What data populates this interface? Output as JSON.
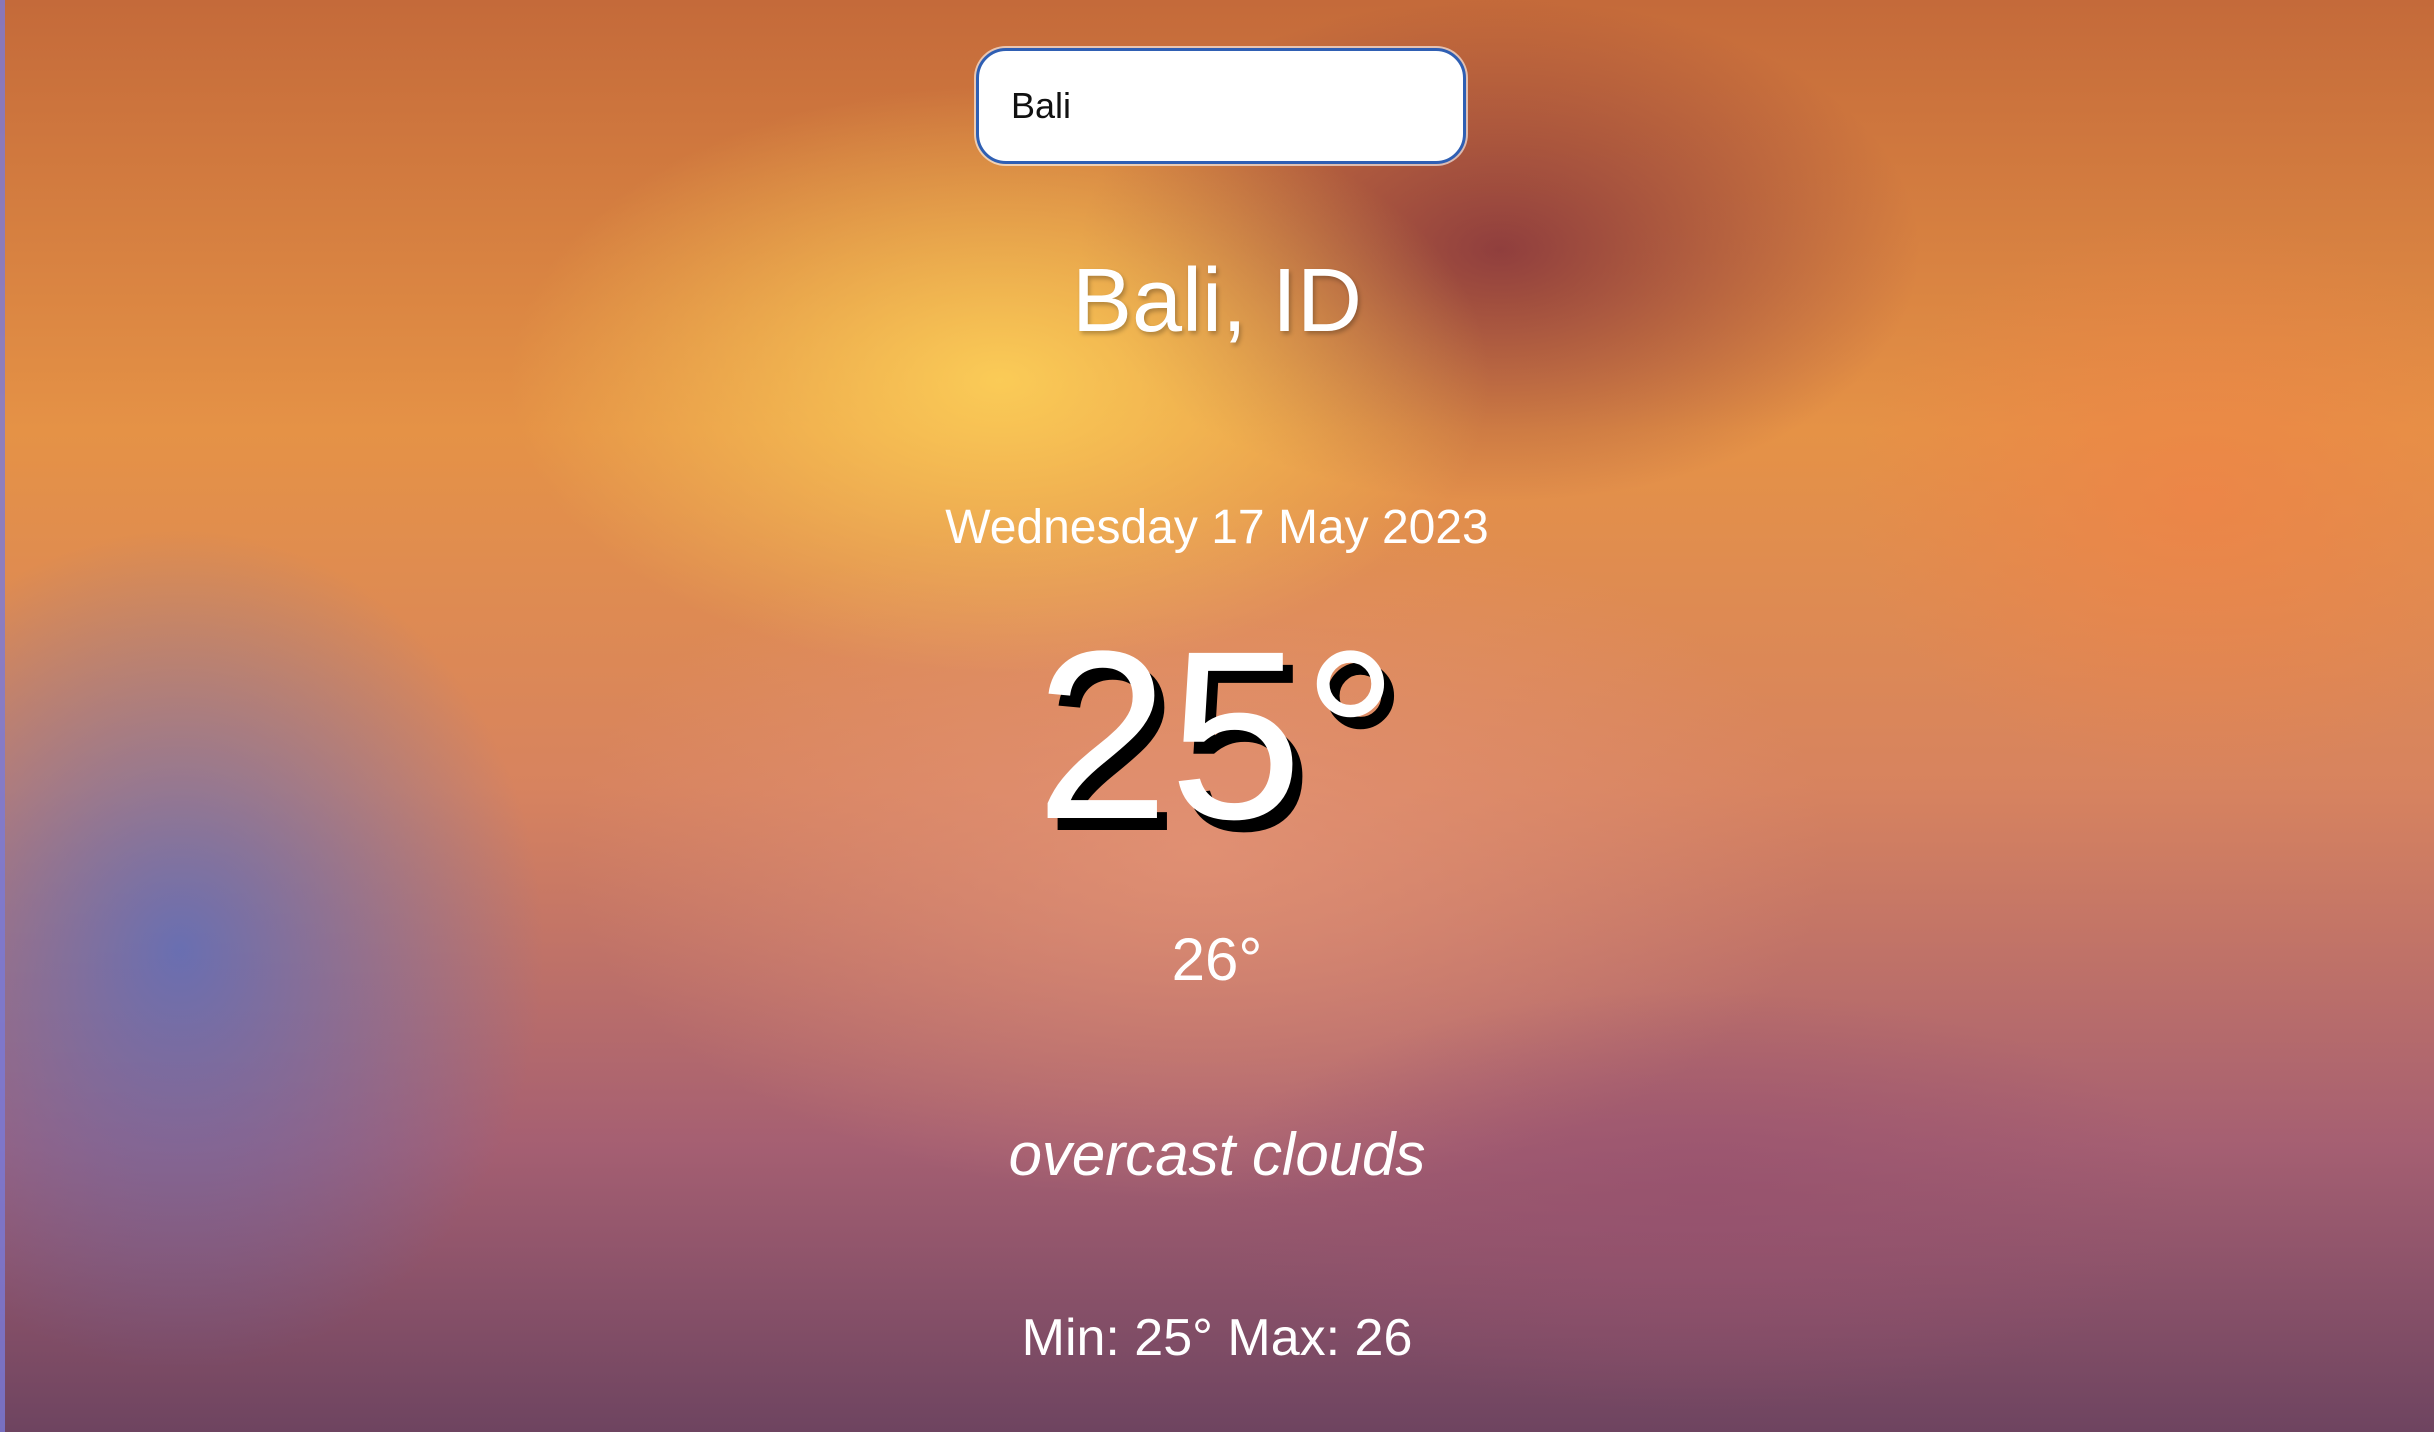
{
  "search": {
    "value": "Bali",
    "placeholder": ""
  },
  "weather": {
    "location": "Bali, ID",
    "date": "Wednesday 17 May 2023",
    "temperature": "25°",
    "feels_like": "26°",
    "description": "overcast clouds",
    "min_max": "Min: 25° Max: 26"
  },
  "colors": {
    "input_border": "#2f5fb3",
    "text": "#ffffff",
    "temperature_shadow": "#000000"
  }
}
